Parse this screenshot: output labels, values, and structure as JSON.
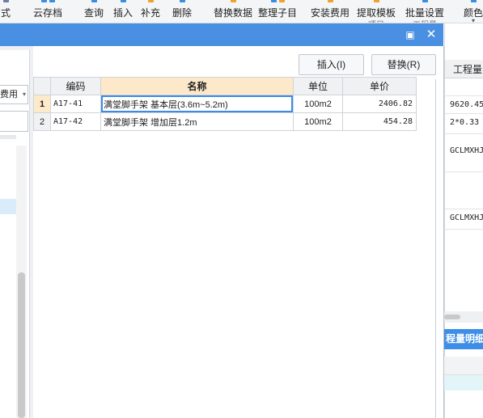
{
  "toolbar": {
    "items": [
      {
        "label": "式",
        "sub": ""
      },
      {
        "label": "云存档",
        "sub": ""
      },
      {
        "label": "查询",
        "sub": ""
      },
      {
        "label": "插入",
        "sub": ""
      },
      {
        "label": "补充",
        "sub": ""
      },
      {
        "label": "删除",
        "sub": ""
      },
      {
        "label": "替换数据",
        "sub": ""
      },
      {
        "label": "整理子目",
        "sub": ""
      },
      {
        "label": "安装费用",
        "sub": ""
      },
      {
        "label": "提取模板",
        "sub": "项目"
      },
      {
        "label": "批量设置",
        "sub": "工程量"
      },
      {
        "label": "颜色",
        "sub": ""
      }
    ]
  },
  "left_panel": {
    "select_value": "费用"
  },
  "dialog": {
    "insert_label": "插入(I)",
    "replace_label": "替换(R)",
    "table": {
      "headers": [
        "",
        "编码",
        "名称",
        "单位",
        "单价"
      ],
      "rows": [
        {
          "num": "1",
          "code": "A17-41",
          "name": "满堂脚手架 基本层(3.6m~5.2m)",
          "unit": "100m2",
          "price": "2406.82"
        },
        {
          "num": "2",
          "code": "A17-42",
          "name": "满堂脚手架 增加层1.2m",
          "unit": "100m2",
          "price": "454.28"
        }
      ]
    }
  },
  "right_panel": {
    "header": "工程量",
    "cells": [
      "9620.45",
      "2*0.33",
      "GCLMXHJ",
      "GCLMXHJ"
    ],
    "detail_tab": "程量明细"
  },
  "colors": {
    "title_bar": "#4a90e2",
    "header_highlight": "#fde8c9",
    "selection_border": "#3c8be4"
  }
}
